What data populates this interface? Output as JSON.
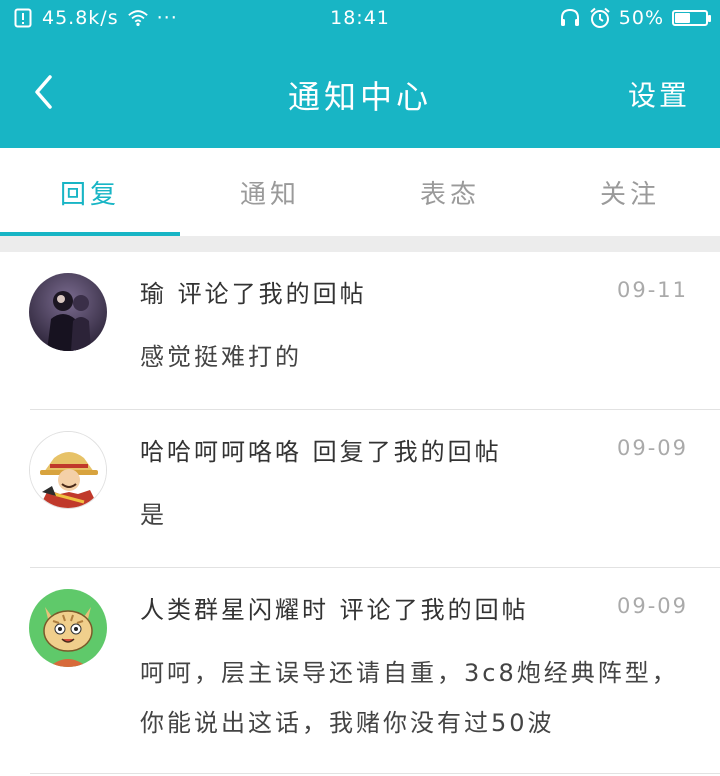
{
  "status_bar": {
    "network_speed": "45.8k/s",
    "more": "···",
    "time": "18:41",
    "battery_percent": "50%",
    "battery_level": 0.5
  },
  "app_bar": {
    "title": "通知中心",
    "settings_label": "设置",
    "back_icon": "chevron-left-icon"
  },
  "tabs": [
    {
      "label": "回复",
      "active": true
    },
    {
      "label": "通知",
      "active": false
    },
    {
      "label": "表态",
      "active": false
    },
    {
      "label": "关注",
      "active": false
    }
  ],
  "messages": [
    {
      "title": "瑜 评论了我的回帖",
      "date": "09-11",
      "body": "感觉挺难打的"
    },
    {
      "title": "哈哈呵呵咯咯 回复了我的回帖",
      "date": "09-09",
      "body": "是"
    },
    {
      "title": "人类群星闪耀时 评论了我的回帖",
      "date": "09-09",
      "body": "呵呵，层主误导还请自重，3c8炮经典阵型，你能说出这话，我赌你没有过50波"
    }
  ],
  "colors": {
    "accent": "#18b5c5",
    "tab_inactive": "#9a9a9a",
    "date": "#aaaaaa"
  }
}
